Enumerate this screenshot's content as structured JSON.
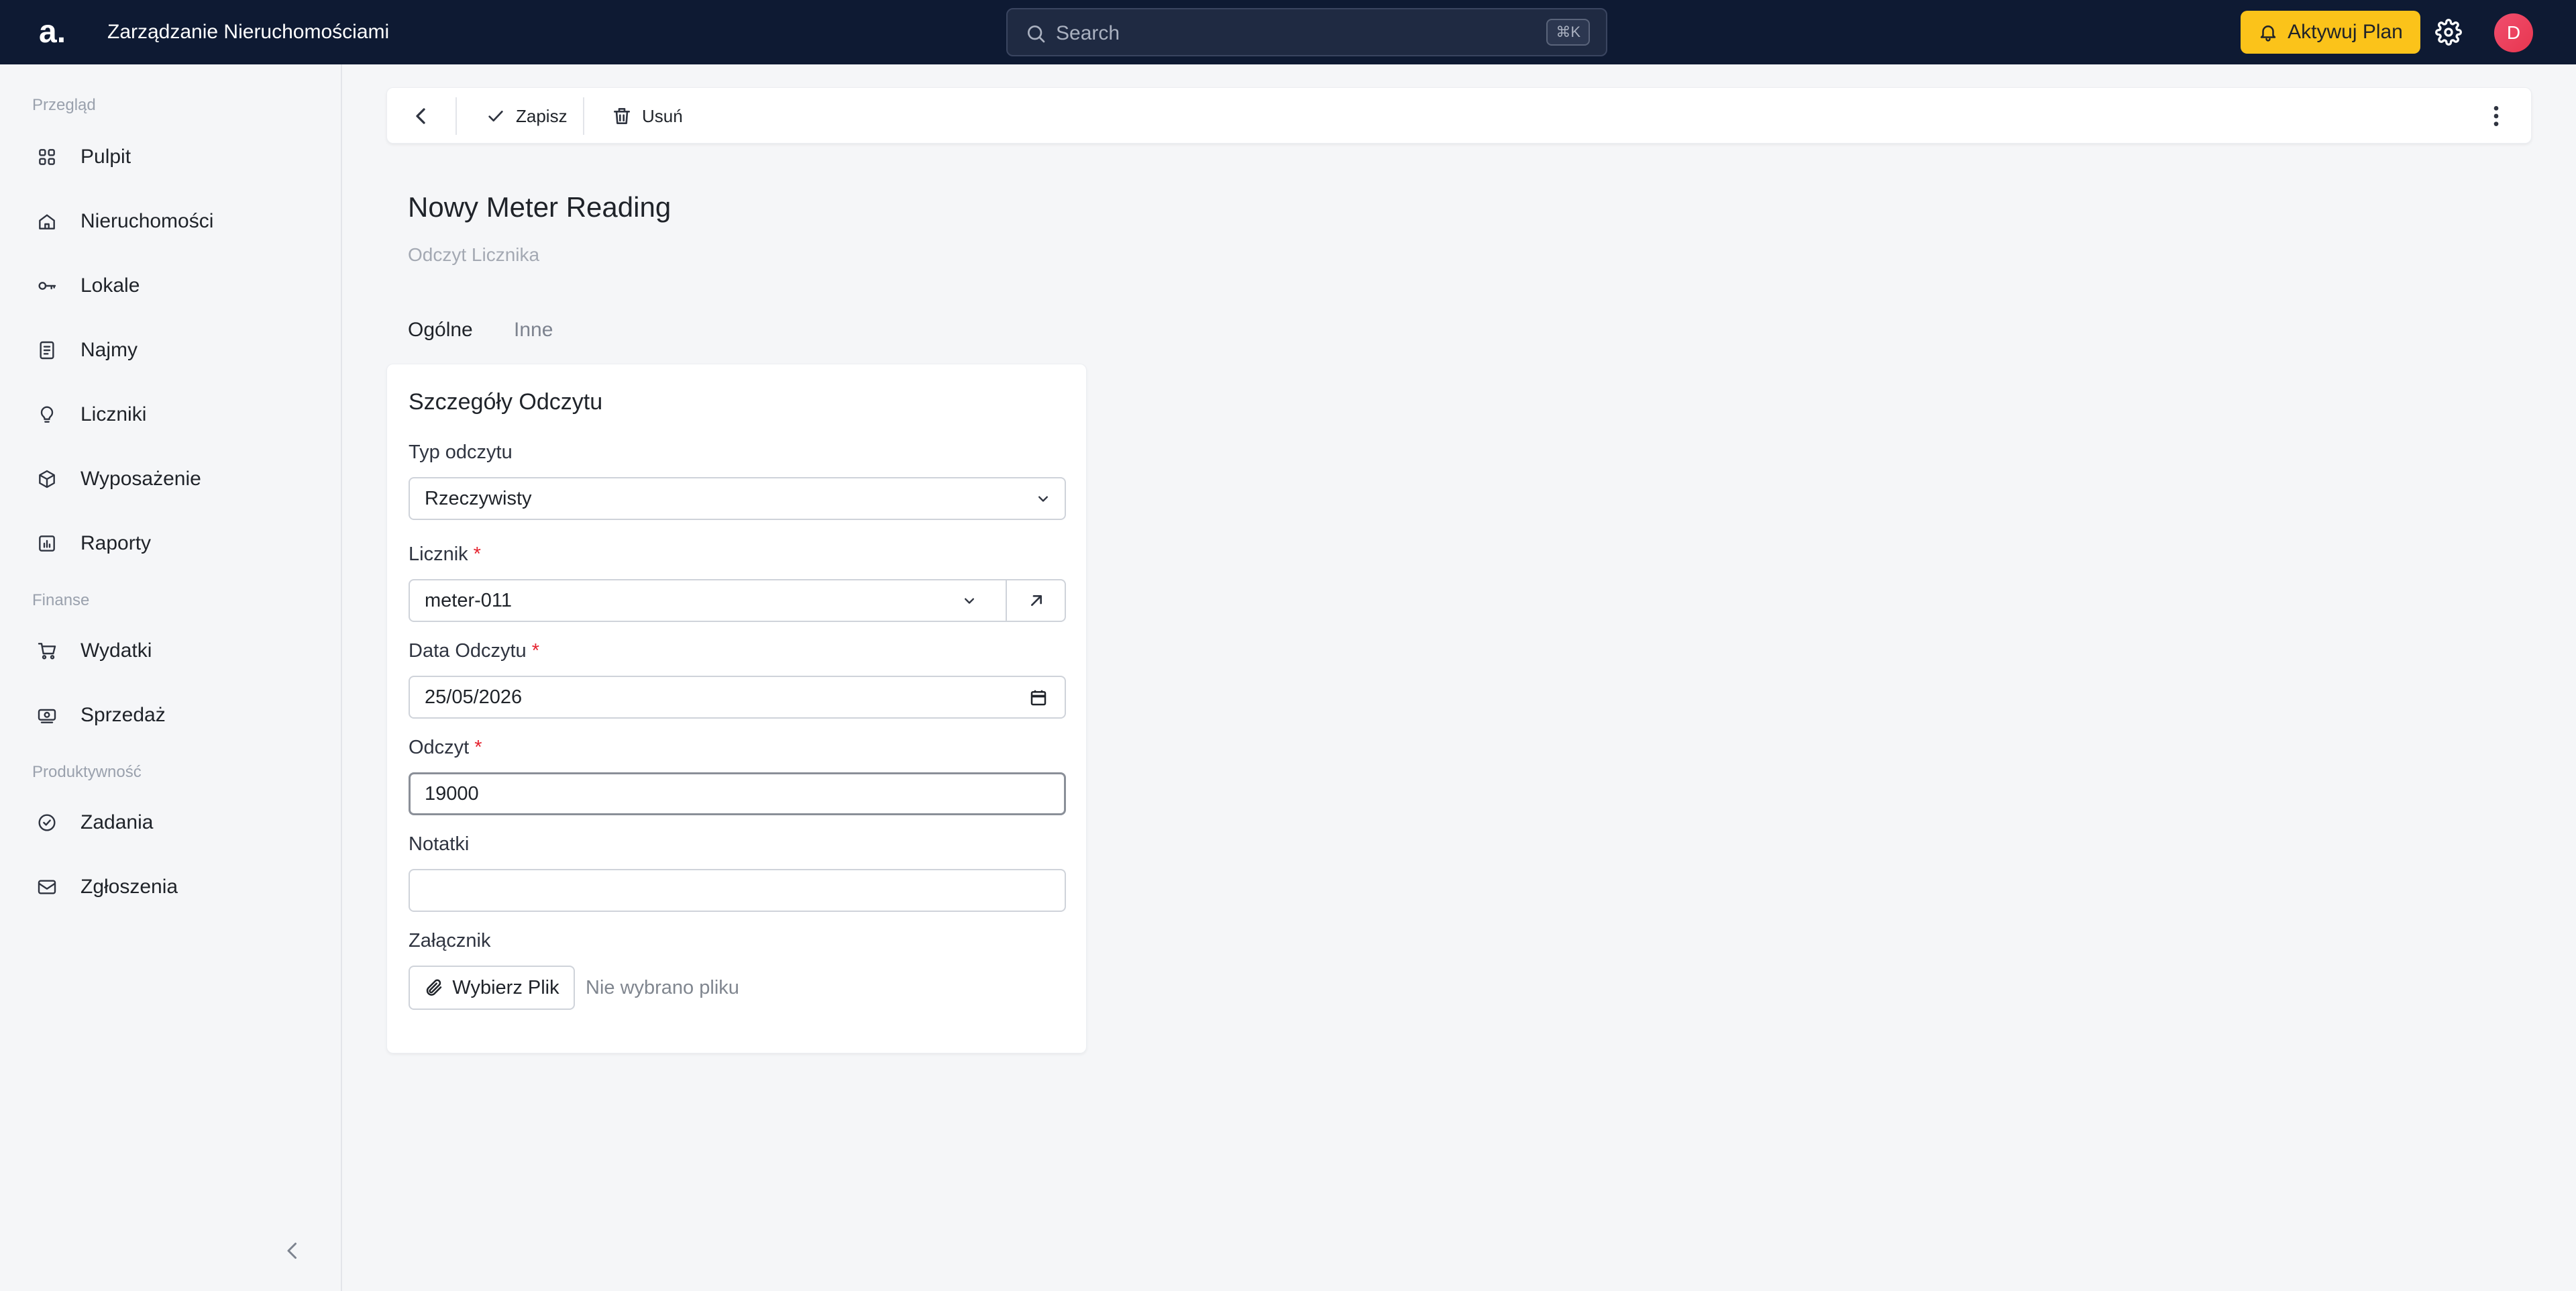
{
  "app": {
    "logo": "a.",
    "title": "Zarządzanie Nieruchomościami"
  },
  "search": {
    "placeholder": "Search",
    "shortcut": "⌘K"
  },
  "header": {
    "upgrade_label": "Aktywuj Plan",
    "avatar_initial": "D",
    "brand_color": "#0e1a33",
    "accent_color": "#fbc31a"
  },
  "sidebar": {
    "sections": [
      {
        "label": "Przegląd",
        "items": [
          {
            "label": "Pulpit",
            "icon": "dashboard-icon"
          },
          {
            "label": "Nieruchomości",
            "icon": "home-icon"
          },
          {
            "label": "Lokale",
            "icon": "key-icon"
          },
          {
            "label": "Najmy",
            "icon": "document-icon"
          },
          {
            "label": "Liczniki",
            "icon": "bulb-icon"
          },
          {
            "label": "Wyposażenie",
            "icon": "box-icon"
          },
          {
            "label": "Raporty",
            "icon": "report-icon"
          }
        ]
      },
      {
        "label": "Finanse",
        "items": [
          {
            "label": "Wydatki",
            "icon": "cart-icon"
          },
          {
            "label": "Sprzedaż",
            "icon": "money-icon"
          }
        ]
      },
      {
        "label": "Produktywność",
        "items": [
          {
            "label": "Zadania",
            "icon": "check-circle-icon"
          },
          {
            "label": "Zgłoszenia",
            "icon": "mail-icon"
          }
        ]
      }
    ]
  },
  "toolbar": {
    "save_label": "Zapisz",
    "delete_label": "Usuń"
  },
  "page": {
    "title": "Nowy Meter Reading",
    "subtitle": "Odczyt Licznika"
  },
  "tabs": [
    {
      "label": "Ogólne",
      "active": true
    },
    {
      "label": "Inne",
      "active": false
    }
  ],
  "form": {
    "section_title": "Szczegóły Odczytu",
    "reading_type": {
      "label": "Typ odczytu",
      "value": "Rzeczywisty"
    },
    "meter": {
      "label": "Licznik",
      "required_mark": "*",
      "value": "meter-011"
    },
    "reading_date": {
      "label": "Data Odczytu",
      "required_mark": "*",
      "value": "25/05/2026"
    },
    "reading": {
      "label": "Odczyt",
      "required_mark": "*",
      "value": "19000"
    },
    "notes": {
      "label": "Notatki",
      "value": ""
    },
    "attachment": {
      "label": "Załącznik",
      "button_label": "Wybierz Plik",
      "status": "Nie wybrano pliku"
    }
  }
}
